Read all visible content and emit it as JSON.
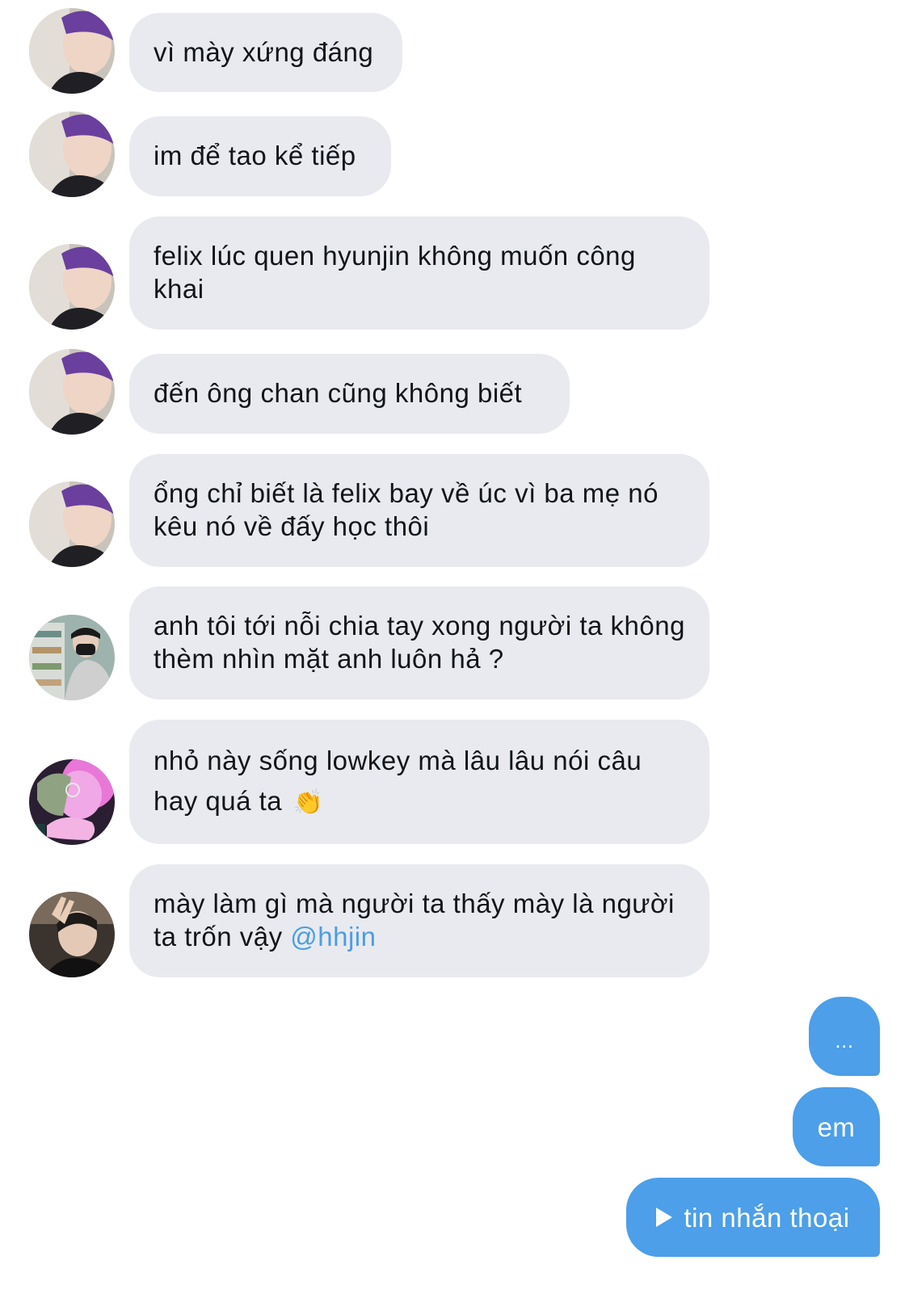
{
  "messages_in": [
    {
      "text": "vì mày xứng đáng",
      "avatar": "user-purple-hair-avatar"
    },
    {
      "text": "im để tao kể tiếp",
      "avatar": "user-purple-hair-avatar"
    },
    {
      "text": "felix lúc quen hyunjin không muốn công khai",
      "avatar": "user-purple-hair-avatar"
    },
    {
      "text": "đến ông chan cũng không biết",
      "avatar": "user-purple-hair-avatar"
    },
    {
      "text": "ổng chỉ biết là felix bay về úc vì ba mẹ nó kêu nó về đấy học thôi",
      "avatar": "user-purple-hair-avatar"
    },
    {
      "text": "anh tôi tới nỗi chia tay xong người ta không thèm nhìn mặt anh luôn hả ?",
      "avatar": "user-mask-store-avatar"
    },
    {
      "text": "nhỏ này sống lowkey mà lâu lâu nói câu hay quá ta",
      "emoji": "👏",
      "avatar": "user-pink-light-avatar"
    },
    {
      "text": "mày làm gì mà người ta thấy mày là người ta trốn vậy",
      "mention": "@hhjin",
      "avatar": "user-peace-sign-avatar"
    }
  ],
  "messages_out": [
    {
      "text": "..."
    },
    {
      "text": "em"
    },
    {
      "text": "tin nhắn thoại",
      "icon": "play-icon"
    }
  ],
  "colors": {
    "incoming_bubble": "#e8eaef",
    "outgoing_bubble": "#4c9fe8",
    "mention": "#4c9de2"
  }
}
